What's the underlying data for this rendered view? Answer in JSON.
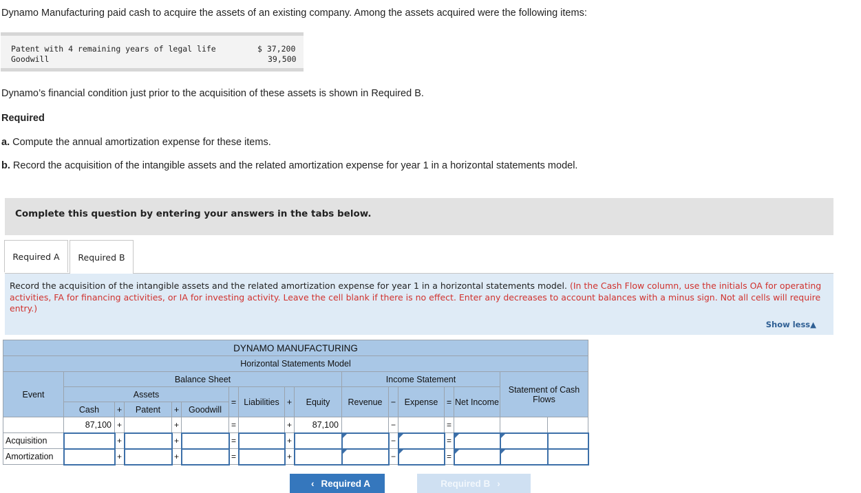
{
  "intro": "Dynamo Manufacturing paid cash to acquire the assets of an existing company. Among the assets acquired were the following items:",
  "assets_table": {
    "rows": [
      {
        "label": "Patent with 4 remaining years of legal life",
        "value": "$ 37,200"
      },
      {
        "label": "Goodwill",
        "value": "39,500"
      }
    ]
  },
  "condition_text": "Dynamo’s financial condition just prior to the acquisition of these assets is shown in Required B.",
  "required_heading": "Required",
  "part_a": {
    "letter": "a.",
    "text": " Compute the annual amortization expense for these items."
  },
  "part_b": {
    "letter": "b.",
    "text": " Record the acquisition of the intangible assets and the related amortization expense for year 1 in a horizontal statements model."
  },
  "complete_bar": "Complete this question by entering your answers in the tabs below.",
  "tabs": [
    {
      "label": "Required A",
      "active": false
    },
    {
      "label": "Required B",
      "active": true
    }
  ],
  "instructions": {
    "main": "Record the acquisition of the intangible assets and the related amortization expense for year 1 in a horizontal statements model.",
    "note": "(In the Cash Flow column, use the initials OA for operating activities, FA for financing activities, or IA for investing activity. Leave the cell blank if there is no effect. Enter any decreases to account balances with a minus sign. Not all cells will require entry.)"
  },
  "show_less": "Show less▲",
  "model": {
    "company": "DYNAMO MANUFACTURING",
    "title": "Horizontal Statements Model",
    "balance_sheet": "Balance Sheet",
    "income_statement": "Income Statement",
    "cash_flows": "Statement of Cash Flows",
    "event": "Event",
    "assets": "Assets",
    "cash": "Cash",
    "patent": "Patent",
    "goodwill": "Goodwill",
    "liabilities": "Liabilities",
    "equity": "Equity",
    "revenue": "Revenue",
    "expense": "Expense",
    "net_income": "Net Income",
    "ops": {
      "plus": "+",
      "eq": "=",
      "minus": "−"
    },
    "beginning": {
      "cash": "87,100",
      "equity": "87,100"
    },
    "events": [
      "Acquisition",
      "Amortization"
    ]
  },
  "nav": {
    "prev": "Required A",
    "next": "Required B"
  }
}
